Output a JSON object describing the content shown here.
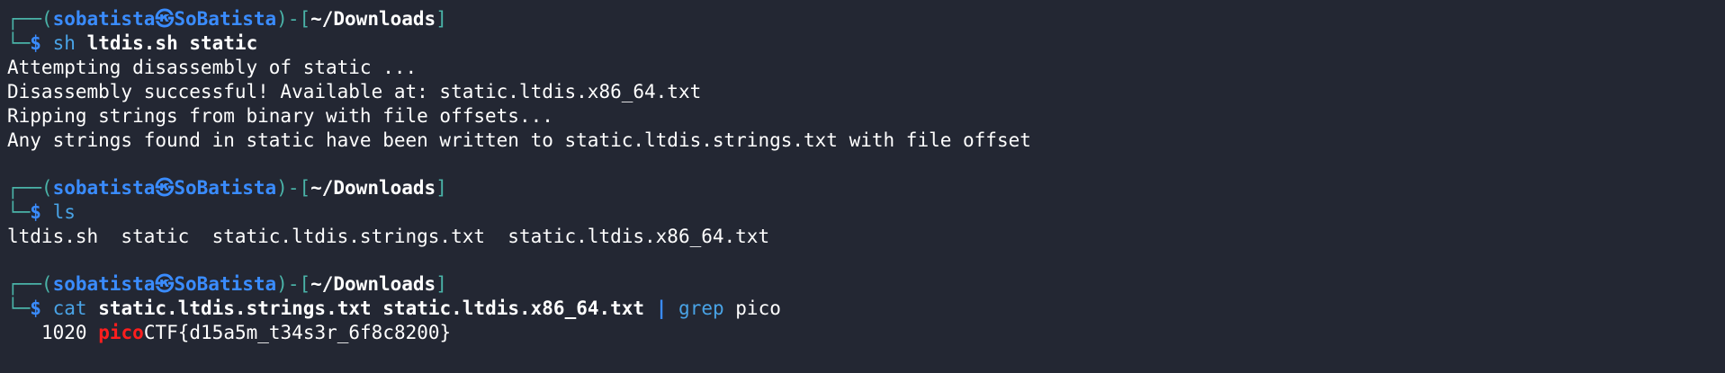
{
  "prompt": {
    "user": "sobatista",
    "at_symbol": "㉿",
    "host": "SoBatista",
    "dir": "~/Downloads",
    "corner_top": "┌──(",
    "close_user": ")-[",
    "close_dir": "]",
    "corner_bottom": "└─",
    "dollar": "$"
  },
  "blocks": [
    {
      "command": {
        "cmd": "sh",
        "args": "ltdis.sh static"
      },
      "output": [
        "Attempting disassembly of static ...",
        "Disassembly successful! Available at: static.ltdis.x86_64.txt",
        "Ripping strings from binary with file offsets...",
        "Any strings found in static have been written to static.ltdis.strings.txt with file offset"
      ]
    },
    {
      "command": {
        "cmd": "ls",
        "args": ""
      },
      "output": [
        "ltdis.sh  static  static.ltdis.strings.txt  static.ltdis.x86_64.txt"
      ]
    },
    {
      "command": {
        "cmd": "cat",
        "args": "static.ltdis.strings.txt static.ltdis.x86_64.txt",
        "pipe": "|",
        "cmd2": "grep",
        "args2": "pico"
      },
      "match": {
        "offset": "1020",
        "highlight": "pico",
        "rest": "CTF{d15a5m_t34s3r_6f8c8200}"
      }
    }
  ],
  "colors": {
    "background": "#232733",
    "prompt_frame": "#4ab3a8",
    "user_host": "#3a8cff",
    "command": "#49a3e6",
    "match_highlight": "#ff1e1e"
  }
}
